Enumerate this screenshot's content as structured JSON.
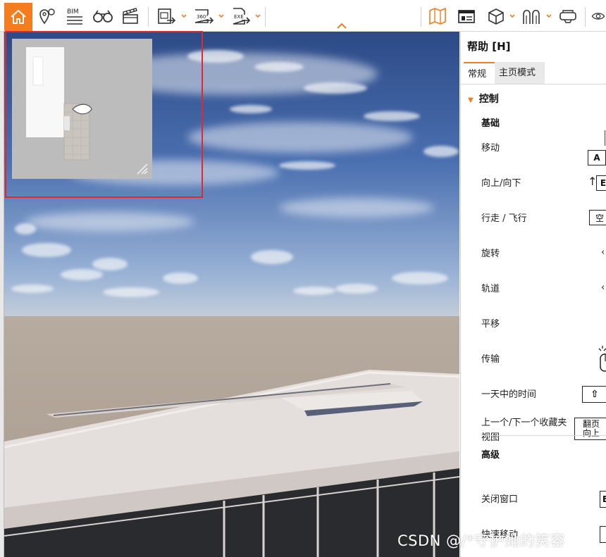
{
  "toolbar": {
    "items": [
      {
        "name": "home",
        "icon": "home-icon",
        "active": true
      },
      {
        "name": "location-pins",
        "icon": "map-pin-icon"
      },
      {
        "name": "bim",
        "icon": "bim-icon",
        "label": "BIM"
      },
      {
        "name": "binoculars",
        "icon": "binoculars-icon"
      },
      {
        "name": "clapperboard",
        "icon": "clapperboard-icon"
      },
      {
        "name": "export-image",
        "icon": "export-image-icon"
      },
      {
        "name": "export-360",
        "icon": "export-360-icon",
        "label": "360°"
      },
      {
        "name": "export-exe",
        "icon": "export-exe-icon",
        "label": "EXE"
      },
      {
        "name": "map",
        "icon": "map-icon"
      },
      {
        "name": "video-editor",
        "icon": "video-editor-icon"
      },
      {
        "name": "cube-view",
        "icon": "cube-icon"
      },
      {
        "name": "archway",
        "icon": "archway-icon"
      },
      {
        "name": "vr-headset",
        "icon": "vr-headset-icon"
      },
      {
        "name": "visibility",
        "icon": "eye-icon"
      }
    ],
    "accent_color": "#f47d20"
  },
  "help": {
    "title": "帮助 [H]",
    "tabs": [
      "常规",
      "主页模式"
    ],
    "active_tab": "常规",
    "section": "控制",
    "basics_header": "基础",
    "rows": [
      {
        "label": "移动",
        "key": "A"
      },
      {
        "label": "向上/向下",
        "key": "E"
      },
      {
        "label": "行走 / 飞行",
        "key": "空"
      },
      {
        "label": "旋转",
        "key": "‹"
      },
      {
        "label": "轨道",
        "key": "‹"
      },
      {
        "label": "平移",
        "key": ""
      },
      {
        "label": "传输",
        "key": ""
      },
      {
        "label": "一天中的时间",
        "key": "⇧"
      },
      {
        "label": "上一个/下一个收藏夹视图",
        "key": "翻页向上"
      }
    ],
    "advanced_header": "高级",
    "advanced_rows": [
      {
        "label": "关闭窗口",
        "key": "E"
      },
      {
        "label": "快速移动",
        "key": ""
      }
    ]
  },
  "watermark": "CSDN @/*守护她的笑容"
}
